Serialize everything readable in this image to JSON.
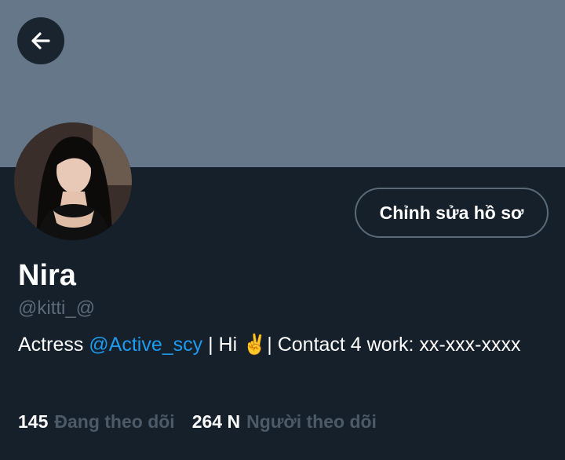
{
  "header": {
    "back_icon": "arrow-left-icon",
    "banner_color": "#66778a"
  },
  "profile": {
    "avatar_icon": "avatar-photo",
    "edit_button_label": "Chỉnh sửa hồ sơ",
    "display_name": "Nira",
    "handle": "@kitti_@",
    "bio": {
      "prefix": "Actress ",
      "mention": "@Active_scy",
      "middle": " | Hi ",
      "emoji": "✌️",
      "suffix": "| Contact 4 work: xx-xxx-xxxx"
    },
    "stats": {
      "following_count": "145",
      "following_label": "Đang theo dõi",
      "followers_count": "264 N",
      "followers_label": "Người theo dõi"
    }
  },
  "colors": {
    "background": "#15202b",
    "accent": "#1d9bf0",
    "muted": "#5d6b78"
  }
}
